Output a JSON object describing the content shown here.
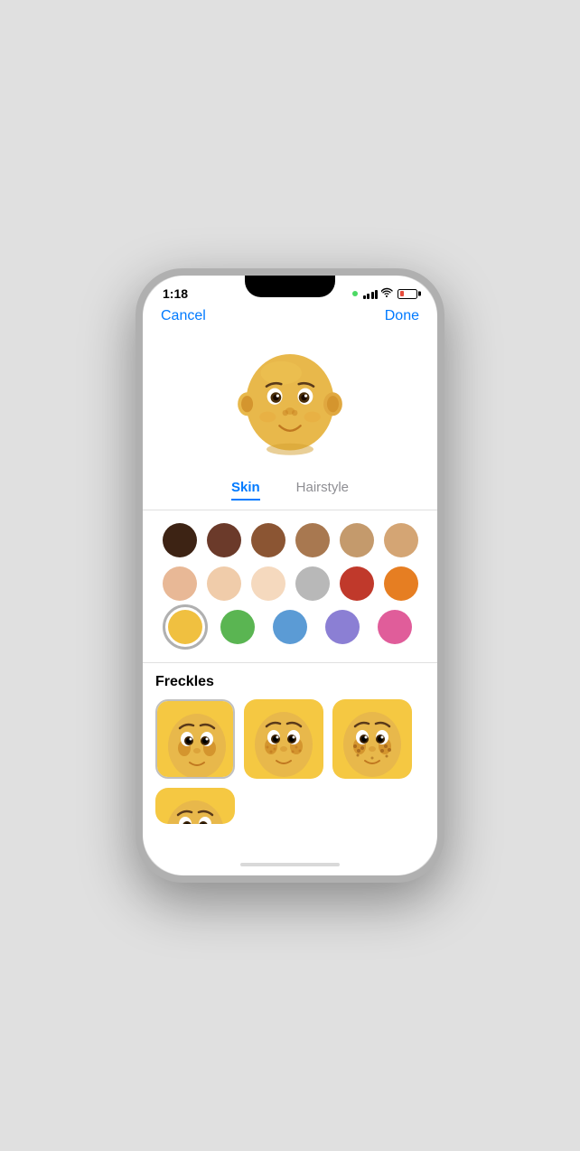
{
  "status_bar": {
    "time": "1:18",
    "signal_dot_color": "#4cd964"
  },
  "nav": {
    "cancel_label": "Cancel",
    "done_label": "Done"
  },
  "tabs": [
    {
      "id": "skin",
      "label": "Skin",
      "active": true
    },
    {
      "id": "hairstyle",
      "label": "Hairstyle",
      "active": false
    }
  ],
  "skin_colors": [
    [
      "#3d2314",
      "#6b3a2a",
      "#8b5533",
      "#a87850",
      "#c49a6c",
      "#d4a574"
    ],
    [
      "#e8b896",
      "#f0ccaa",
      "#f5d9be",
      "#b8b8b8",
      "#c0392b",
      "#e67e22"
    ],
    [
      "#f0c040",
      "#5ab552",
      "#5b9bd5",
      "#8b7fd4",
      "#e05d9a"
    ]
  ],
  "selected_color_index": [
    2,
    0
  ],
  "freckles": {
    "title": "Freckles",
    "items": [
      {
        "id": "none",
        "label": "No freckles",
        "selected": true
      },
      {
        "id": "light",
        "label": "Light freckles",
        "selected": false
      },
      {
        "id": "medium",
        "label": "Medium freckles",
        "selected": false
      },
      {
        "id": "heavy",
        "label": "Heavy freckles (partial)",
        "selected": false
      }
    ]
  }
}
